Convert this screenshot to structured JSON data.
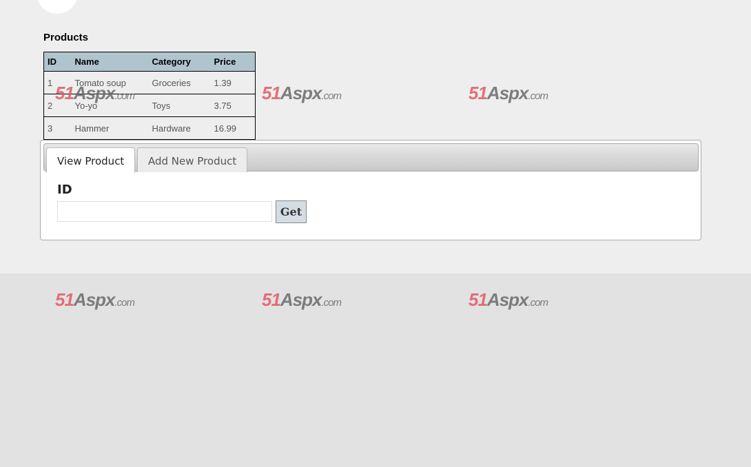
{
  "products_title": "Products",
  "table": {
    "headers": [
      "ID",
      "Name",
      "Category",
      "Price"
    ],
    "rows": [
      [
        "1",
        "Tomato soup",
        "Groceries",
        "1.39"
      ],
      [
        "2",
        "Yo-yo",
        "Toys",
        "3.75"
      ],
      [
        "3",
        "Hammer",
        "Hardware",
        "16.99"
      ]
    ]
  },
  "tabs": {
    "view_label": "View Product",
    "add_label": "Add New Product"
  },
  "view_form": {
    "id_label": "ID",
    "id_value": "",
    "get_label": "Get"
  },
  "watermark": {
    "num": "51",
    "brand": "Aspx",
    "suffix": ".com"
  },
  "colors": {
    "header_bg": "#b0c4ce",
    "watermark_red": "#e05a66"
  }
}
